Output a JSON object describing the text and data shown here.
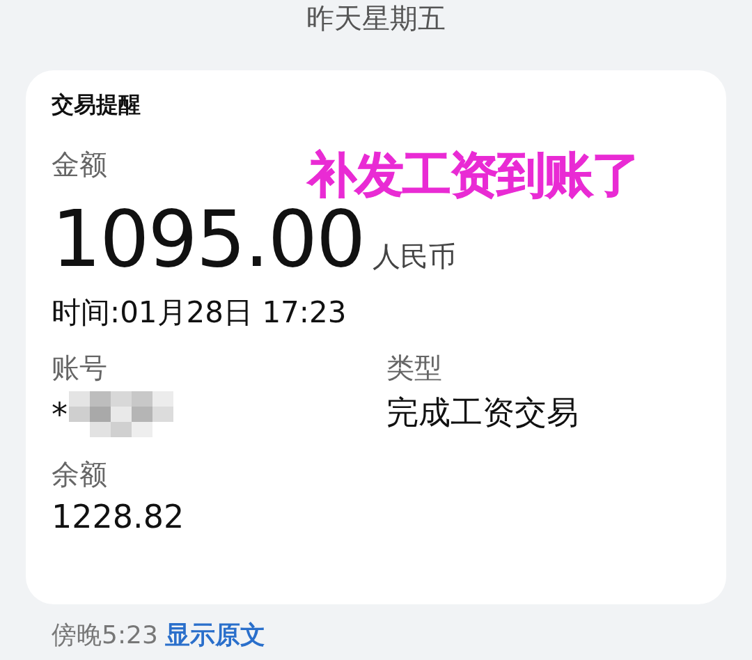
{
  "date_header": "昨天星期五",
  "card": {
    "title": "交易提醒",
    "amount_label": "金额",
    "annotation": "补发工资到账了",
    "amount": "1095.00",
    "currency": "人民币",
    "time": "时间:01月28日 17:23",
    "fields": [
      {
        "label": "账号",
        "value": "*",
        "kind": "masked"
      },
      {
        "label": "类型",
        "value": "完成工资交易",
        "kind": "text"
      }
    ],
    "balance_label": "余额",
    "balance": "1228.82"
  },
  "footer": {
    "time": "傍晚5:23",
    "link": "显示原文"
  }
}
